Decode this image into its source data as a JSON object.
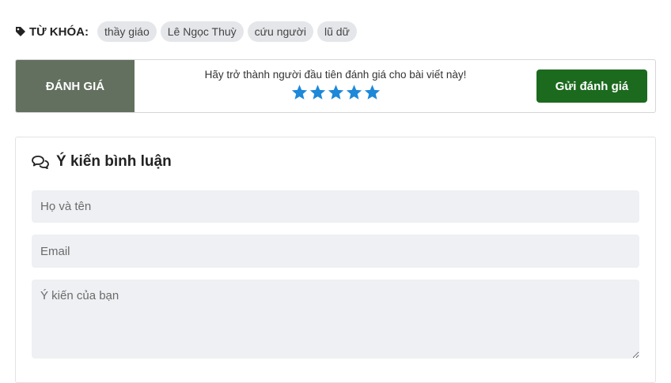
{
  "tags": {
    "label": "TỪ KHÓA:",
    "icon": "tag-icon",
    "items": [
      "thầy giáo",
      "Lê Ngọc Thuỳ",
      "cứu người",
      "lũ dữ"
    ]
  },
  "rating": {
    "label": "ĐÁNH GIÁ",
    "prompt": "Hãy trở thành người đầu tiên đánh giá cho bài viết này!",
    "stars_total": 5,
    "star_color": "#1e88d9",
    "submit_label": "Gửi đánh giá",
    "label_bg": "#63705f",
    "button_bg": "#1c6a1e"
  },
  "comments": {
    "icon": "comments-icon",
    "title": "Ý kiến bình luận",
    "name_placeholder": "Họ và tên",
    "email_placeholder": "Email",
    "comment_placeholder": "Ý kiến của bạn"
  }
}
